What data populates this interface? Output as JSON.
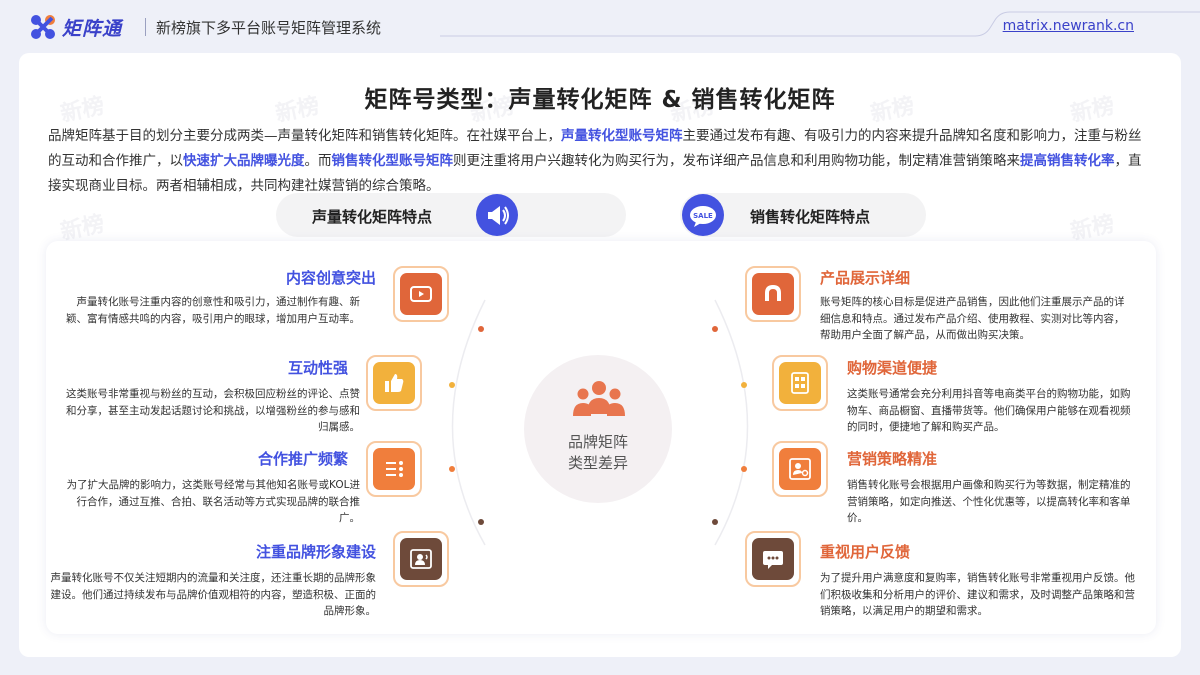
{
  "header": {
    "brand": "矩阵通",
    "subtitle": "新榜旗下多平台账号矩阵管理系统",
    "domain": "matrix.newrank.cn"
  },
  "watermark_text": "新榜",
  "main_title": "矩阵号类型：声量转化矩阵 & 销售转化矩阵",
  "intro": {
    "p1": "品牌矩阵基于目的划分主要分成两类",
    "p2": "声量转化矩阵和销售转化矩阵。在社媒平台上，",
    "hl1": "声量转化型账号矩阵",
    "p3": "主要通过发布有趣、有吸引力的内容来提升品牌知名度和影响力，注重与粉丝的互动和合作推广，以",
    "hl2": "快速扩大品牌曝光度",
    "p4": "。而",
    "hl3": "销售转化型账号矩阵",
    "p5": "则更注重将用户兴趣转化为购买行为，发布详细产品信息和利用购物功能，制定精准营销策略来",
    "hl4": "提高销售转化率",
    "p6": "，直接实现商业目标。两者相辅相成，共同构建社媒营销的综合策略。"
  },
  "left_pill": "声量转化矩阵特点",
  "right_pill": "销售转化矩阵特点",
  "center": {
    "line1": "品牌矩阵",
    "line2": "类型差异"
  },
  "left_features": [
    {
      "title": "内容创意突出",
      "desc": "声量转化账号注重内容的创意性和吸引力，通过制作有趣、新颖、富有情感共鸣的内容，吸引用户的眼球，增加用户互动率。",
      "icon": "video-play-icon",
      "color": "#e0663a"
    },
    {
      "title": "互动性强",
      "desc": "这类账号非常重视与粉丝的互动，会积极回应粉丝的评论、点赞和分享，甚至主动发起话题讨论和挑战，以增强粉丝的参与感和归属感。",
      "icon": "thumbs-up-icon",
      "color": "#f2b13c"
    },
    {
      "title": "合作推广频繁",
      "desc": "为了扩大品牌的影响力，这类账号经常与其他知名账号或KOL进行合作，通过互推、合拍、联名活动等方式实现品牌的联合推广。",
      "icon": "list-icon",
      "color": "#f07e3c"
    },
    {
      "title": "注重品牌形象建设",
      "desc": "声量转化账号不仅关注短期内的流量和关注度，还注重长期的品牌形象建设。他们通过持续发布与品牌价值观相符的内容，塑造积极、正面的品牌形象。",
      "icon": "user-voice-icon",
      "color": "#6e4a3a"
    }
  ],
  "right_features": [
    {
      "title": "产品展示详细",
      "desc": "账号矩阵的核心目标是促进产品销售，因此他们注重展示产品的详细信息和特点。通过发布产品介绍、使用教程、实测对比等内容，帮助用户全面了解产品，从而做出购买决策。",
      "icon": "magnet-icon",
      "color": "#e0663a"
    },
    {
      "title": "购物渠道便捷",
      "desc": "这类账号通常会充分利用抖音等电商类平台的购物功能，如购物车、商品橱窗、直播带货等。他们确保用户能够在观看视频的同时，便捷地了解和购买产品。",
      "icon": "catalog-icon",
      "color": "#f2b13c"
    },
    {
      "title": "营销策略精准",
      "desc": "销售转化账号会根据用户画像和购买行为等数据，制定精准的营销策略，如定向推送、个性化优惠等，以提高转化率和客单价。",
      "icon": "user-settings-icon",
      "color": "#f07e3c"
    },
    {
      "title": "重视用户反馈",
      "desc": "为了提升用户满意度和复购率，销售转化账号非常重视用户反馈。他们积极收集和分析用户的评价、建议和需求，及时调整产品策略和营销策略，以满足用户的期望和需求。",
      "icon": "chat-icon",
      "color": "#6e4a3a"
    }
  ]
}
